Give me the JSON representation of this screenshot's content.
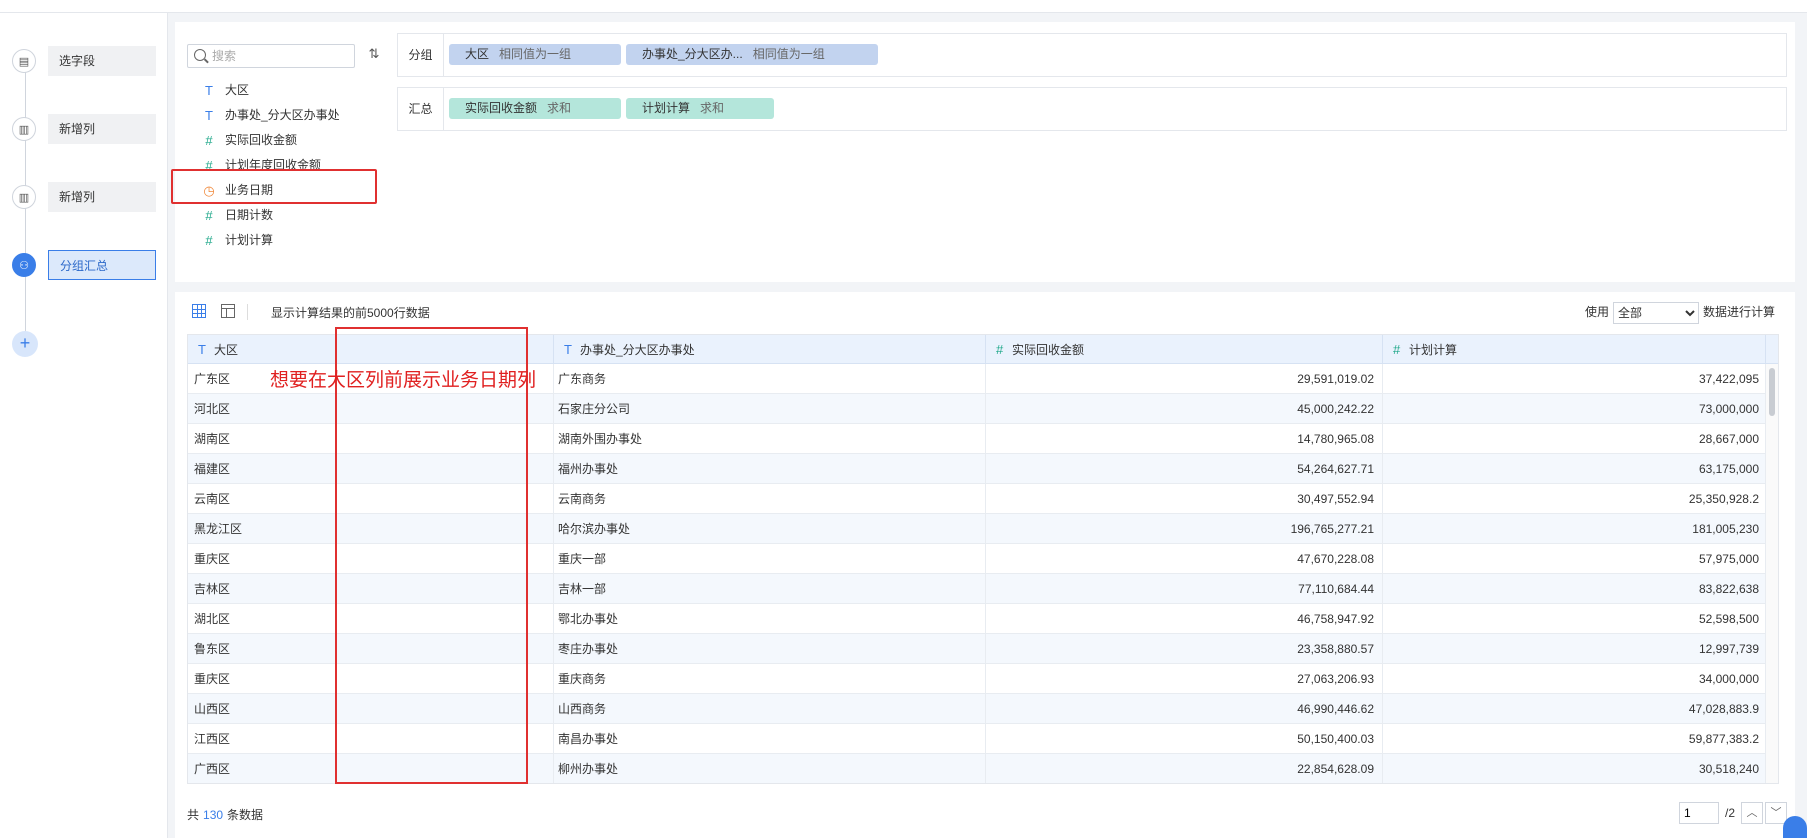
{
  "steps": [
    {
      "label": "选字段",
      "icon": "select-fields-icon"
    },
    {
      "label": "新增列",
      "icon": "add-column-icon"
    },
    {
      "label": "新增列",
      "icon": "add-column-icon"
    },
    {
      "label": "分组汇总",
      "icon": "group-summary-icon",
      "active": true
    }
  ],
  "add_step": "+",
  "search": {
    "placeholder": "搜索"
  },
  "fields": [
    {
      "type": "T",
      "name": "大区"
    },
    {
      "type": "T",
      "name": "办事处_分大区办事处"
    },
    {
      "type": "#",
      "name": "实际回收金额"
    },
    {
      "type": "#",
      "name": "计划年度回收金额"
    },
    {
      "type": "date",
      "name": "业务日期"
    },
    {
      "type": "#",
      "name": "日期计数"
    },
    {
      "type": "#",
      "name": "计划计算"
    }
  ],
  "group": {
    "label": "分组",
    "chips": [
      {
        "name": "大区",
        "sub": "相同值为一组"
      },
      {
        "name": "办事处_分大区办...",
        "sub": "相同值为一组"
      }
    ]
  },
  "summary": {
    "label": "汇总",
    "chips": [
      {
        "name": "实际回收金额",
        "sub": "求和"
      },
      {
        "name": "计划计算",
        "sub": "求和"
      }
    ]
  },
  "toolbar": {
    "info": "显示计算结果的前5000行数据",
    "use_label": "使用",
    "use_value": "全部",
    "calc_label": "数据进行计算"
  },
  "table": {
    "columns": [
      {
        "type": "T",
        "name": "大区"
      },
      {
        "type": "T",
        "name": "办事处_分大区办事处"
      },
      {
        "type": "#",
        "name": "实际回收金额"
      },
      {
        "type": "#",
        "name": "计划计算"
      }
    ],
    "rows": [
      [
        "广东区",
        "广东商务",
        "29,591,019.02",
        "37,422,095"
      ],
      [
        "河北区",
        "石家庄分公司",
        "45,000,242.22",
        "73,000,000"
      ],
      [
        "湖南区",
        "湖南外围办事处",
        "14,780,965.08",
        "28,667,000"
      ],
      [
        "福建区",
        "福州办事处",
        "54,264,627.71",
        "63,175,000"
      ],
      [
        "云南区",
        "云南商务",
        "30,497,552.94",
        "25,350,928.2"
      ],
      [
        "黑龙江区",
        "哈尔滨办事处",
        "196,765,277.21",
        "181,005,230"
      ],
      [
        "重庆区",
        "重庆一部",
        "47,670,228.08",
        "57,975,000"
      ],
      [
        "吉林区",
        "吉林一部",
        "77,110,684.44",
        "83,822,638"
      ],
      [
        "湖北区",
        "鄂北办事处",
        "46,758,947.92",
        "52,598,500"
      ],
      [
        "鲁东区",
        "枣庄办事处",
        "23,358,880.57",
        "12,997,739"
      ],
      [
        "重庆区",
        "重庆商务",
        "27,063,206.93",
        "34,000,000"
      ],
      [
        "山西区",
        "山西商务",
        "46,990,446.62",
        "47,028,883.9"
      ],
      [
        "江西区",
        "南昌办事处",
        "50,150,400.03",
        "59,877,383.2"
      ],
      [
        "广西区",
        "柳州办事处",
        "22,854,628.09",
        "30,518,240"
      ]
    ]
  },
  "annotation": "想要在大区列前展示业务日期列",
  "footer": {
    "prefix": "共",
    "count": "130",
    "suffix": "条数据"
  },
  "pager": {
    "page": "1",
    "total": "/2"
  },
  "colors": {
    "accent": "#3a7ee8",
    "annotation": "#e03030",
    "group_chip": "#c2d3ef",
    "summary_chip": "#b4e6db"
  }
}
